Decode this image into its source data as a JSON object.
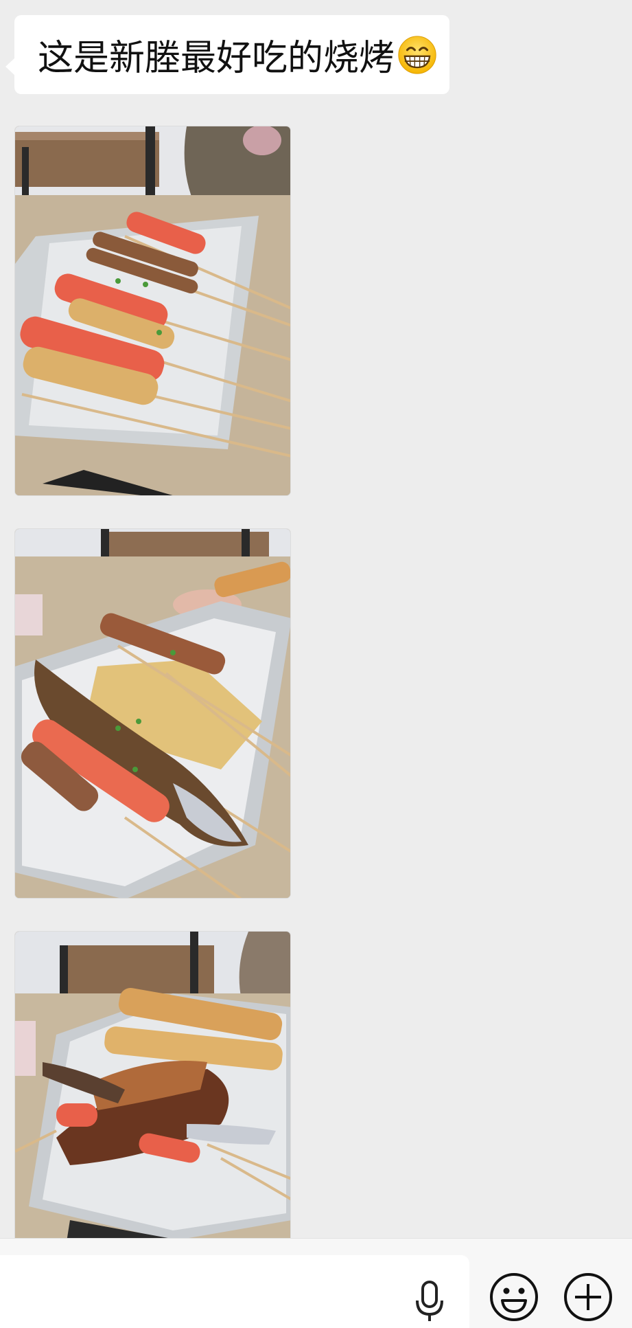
{
  "chat": {
    "message_text": "这是新塍最好吃的烧烤",
    "emoji_name": "grinning-face-emoji",
    "photos": [
      {
        "icon": "bbq-skewers-photo"
      },
      {
        "icon": "bbq-fish-photo"
      },
      {
        "icon": "bbq-meat-photo"
      }
    ]
  },
  "input_bar": {
    "placeholder": "",
    "voice_icon": "microphone-icon",
    "emoji_icon": "smiley-icon",
    "more_icon": "plus-circle-icon"
  },
  "colors": {
    "background": "#ededed",
    "bubble": "#ffffff",
    "input_bar": "#f7f7f7"
  }
}
